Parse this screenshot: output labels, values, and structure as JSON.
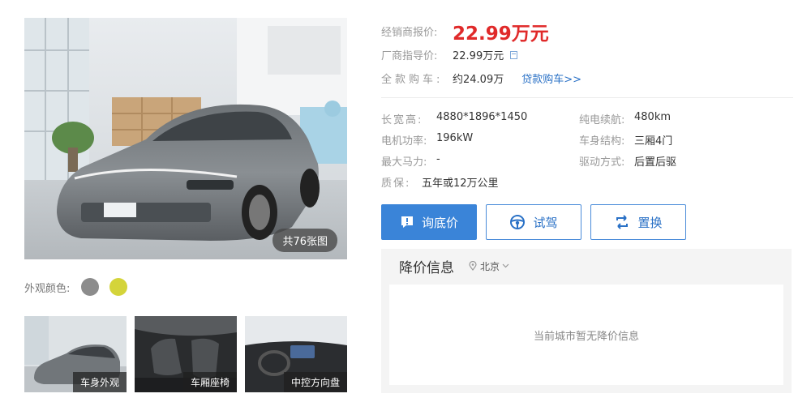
{
  "gallery": {
    "photo_count": "共76张图",
    "colors_label": "外观颜色:",
    "colors": [
      "#8c8c8c",
      "#d4d43a"
    ],
    "thumbnails": [
      {
        "label": "车身外观"
      },
      {
        "label": "车厢座椅"
      },
      {
        "label": "中控方向盘"
      }
    ]
  },
  "price": {
    "dealer_label": "经销商报价:",
    "dealer_value": "22.99万元",
    "guide_label": "厂商指导价:",
    "guide_value": "22.99万元",
    "full_label": "全款购车:",
    "full_value": "约24.09万",
    "loan_link": "贷款购车>>"
  },
  "specs": {
    "dimensions_label": "长宽高:",
    "dimensions_value": "4880*1896*1450",
    "range_label": "纯电续航:",
    "range_value": "480km",
    "motor_label": "电机功率:",
    "motor_value": "196kW",
    "body_label": "车身结构:",
    "body_value": "三厢4门",
    "hp_label": "最大马力:",
    "hp_value": "-",
    "drive_label": "驱动方式:",
    "drive_value": "后置后驱",
    "warranty_label": "质保:",
    "warranty_value": "五年或12万公里"
  },
  "actions": {
    "inquiry": "询底价",
    "test_drive": "试驾",
    "trade_in": "置换"
  },
  "discount": {
    "title": "降价信息",
    "city": "北京",
    "empty_message": "当前城市暂无降价信息"
  },
  "theme": {
    "accent": "#3a84d8",
    "price_red": "#e02a2a",
    "link_blue": "#2a71c6"
  }
}
